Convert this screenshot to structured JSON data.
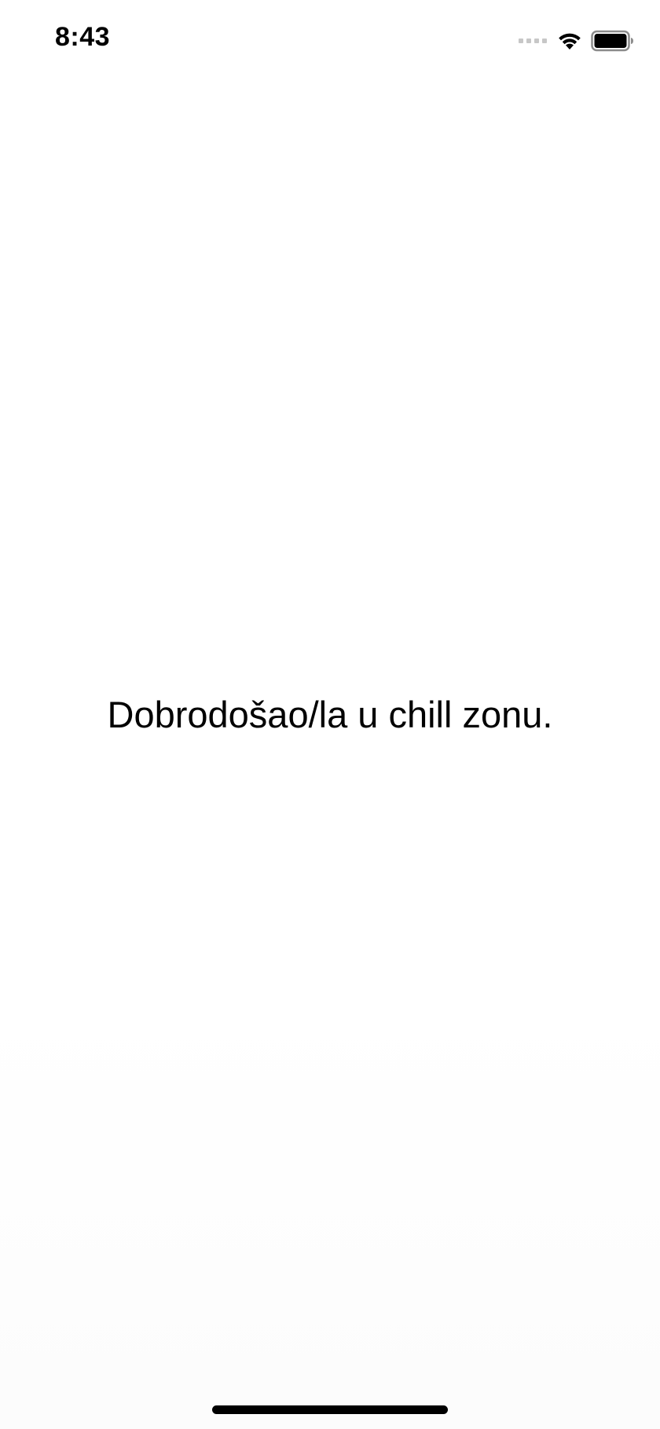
{
  "status_bar": {
    "time": "8:43",
    "icons": [
      "cellular-signal-icon",
      "wifi-icon",
      "battery-icon"
    ]
  },
  "main": {
    "welcome_text": "Dobrodošao/la u chill zonu."
  },
  "colors": {
    "background": "#ffffff",
    "text": "#000000",
    "inactive_signal": "#c7c7c7"
  }
}
